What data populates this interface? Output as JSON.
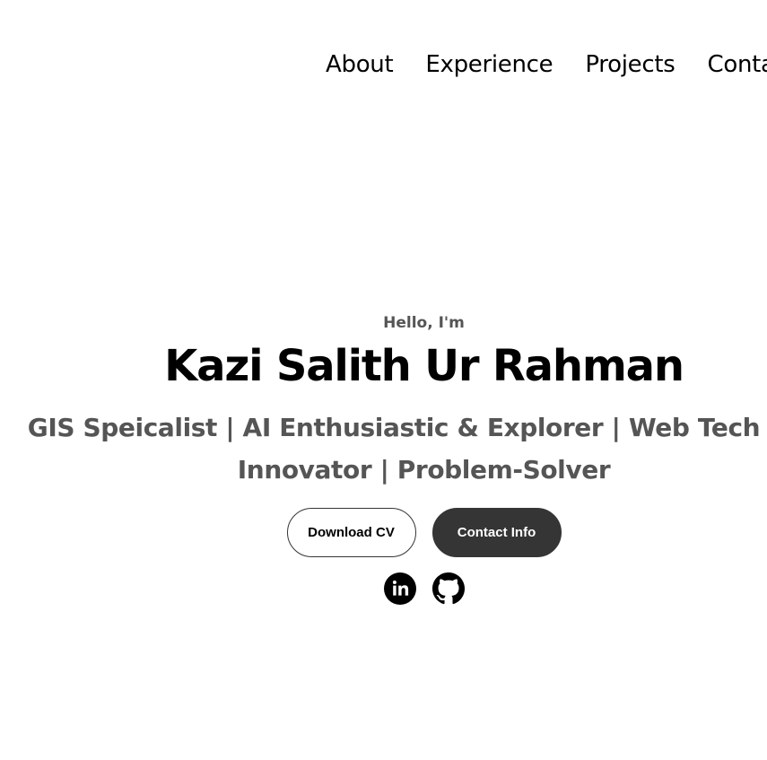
{
  "nav": {
    "items": [
      {
        "label": "About"
      },
      {
        "label": "Experience"
      },
      {
        "label": "Projects"
      },
      {
        "label": "Contact"
      }
    ]
  },
  "hero": {
    "greeting": "Hello, I'm",
    "name": "Kazi Salith Ur Rahman",
    "tagline_line1": "GIS Speicalist | AI Enthusiastic & Explorer | Web Tech and",
    "tagline_line2": "Innovator | Problem-Solver",
    "download_cv_label": "Download CV",
    "contact_info_label": "Contact Info"
  },
  "socials": {
    "icons": [
      "linkedin-icon",
      "github-icon"
    ]
  },
  "colors": {
    "text_primary": "#000000",
    "text_secondary": "#555555",
    "button_dark": "#353535",
    "background": "#ffffff"
  }
}
